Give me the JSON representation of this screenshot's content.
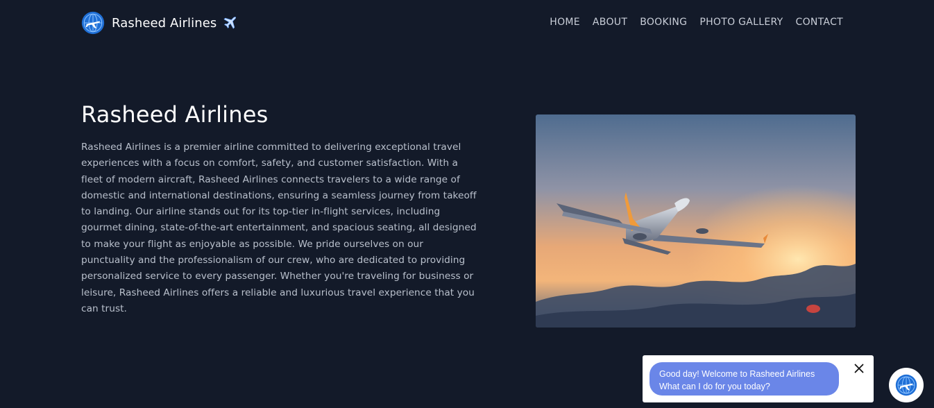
{
  "nav": {
    "brand_name": "Rasheed Airlines",
    "brand_icon": "globe-plane-logo-icon",
    "brand_plane_icon": "airplane-icon",
    "links": [
      "HOME",
      "ABOUT",
      "BOOKING",
      "PHOTO GALLERY",
      "CONTACT"
    ]
  },
  "hero": {
    "title": "Rasheed Airlines",
    "description": "Rasheed Airlines is a premier airline committed to delivering exceptional travel experiences with a focus on comfort, safety, and customer satisfaction. With a fleet of modern aircraft, Rasheed Airlines connects travelers to a wide range of domestic and international destinations, ensuring a seamless journey from takeoff to landing. Our airline stands out for its top-tier in-flight services, including gourmet dining, state-of-the-art entertainment, and spacious seating, all designed to make your flight as enjoyable as possible. We pride ourselves on our punctuality and the professionalism of our crew, who are dedicated to providing personalized service to every passenger. Whether you're traveling for business or leisure, Rasheed Airlines offers a reliable and luxurious travel experience that you can trust.",
    "image": "airplane-taking-off-at-sunset"
  },
  "chat": {
    "line1": "Good day! Welcome to Rasheed Airlines",
    "line2": "What can I do for you today?",
    "close_icon": "close-icon",
    "launcher_icon": "globe-plane-logo-icon"
  },
  "colors": {
    "background": "#131a29",
    "chat_bubble": "#6a86e8",
    "nav_text": "#c9ced8",
    "body_text": "#b9c0cc"
  }
}
